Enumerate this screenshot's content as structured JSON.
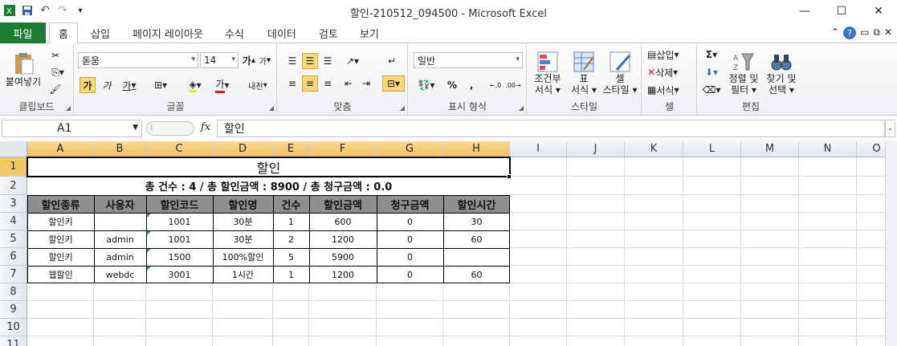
{
  "window": {
    "title": "할인-210512_094500  -  Microsoft Excel",
    "minimize": "—",
    "maximize": "☐",
    "close": "✕"
  },
  "qat": {
    "undo": "↶",
    "redo": "↷",
    "customize": "▾"
  },
  "tabs": {
    "file": "파일",
    "items": [
      "홈",
      "삽입",
      "페이지 레이아웃",
      "수식",
      "데이터",
      "검토",
      "보기"
    ]
  },
  "ribbon": {
    "clipboard": {
      "paste": "붙여넣기",
      "label": "클립보드"
    },
    "font": {
      "name": "돋움",
      "size": "14",
      "grow": "가",
      "shrink": "가",
      "bold": "가",
      "italic": "가",
      "underline": "가",
      "phonetic": "내천",
      "fontcolor": "가",
      "label": "글꼴"
    },
    "align": {
      "label": "맞춤"
    },
    "number": {
      "format": "일반",
      "percent": "%",
      "comma": ",",
      "label": "표시 형식"
    },
    "styles": {
      "cond": [
        "조건부",
        "서식 ▾"
      ],
      "table": [
        "표",
        "서식 ▾"
      ],
      "cell": [
        "셀",
        "스타일 ▾"
      ],
      "label": "스타일"
    },
    "cells": {
      "insert": "삽입",
      "delete": "삭제",
      "format": "서식",
      "label": "셀"
    },
    "editing": {
      "sort": [
        "정렬 및",
        "필터 ▾"
      ],
      "find": [
        "찾기 및",
        "선택 ▾"
      ],
      "sigma": "Σ",
      "label": "편집"
    }
  },
  "formula_bar": {
    "namebox": "A1",
    "fx": "fx",
    "content": "할인"
  },
  "columns": [
    "A",
    "B",
    "C",
    "D",
    "E",
    "F",
    "G",
    "H",
    "I",
    "J",
    "K",
    "L",
    "M",
    "N",
    "O"
  ],
  "rows": [
    "1",
    "2",
    "3",
    "4",
    "5",
    "6",
    "7",
    "8",
    "9",
    "10",
    "11"
  ],
  "sheet": {
    "title": "할인",
    "summary": "총 건수 : 4 / 총 할인금액 : 8900 / 총 청구금액 : 0.0",
    "headers": [
      "할인종류",
      "사용자",
      "할인코드",
      "할인명",
      "건수",
      "할인금액",
      "청구금액",
      "할인시간"
    ],
    "data": [
      [
        "할인키",
        "",
        "1001",
        "30분",
        "1",
        "600",
        "0",
        "30"
      ],
      [
        "할인키",
        "admin",
        "1001",
        "30분",
        "2",
        "1200",
        "0",
        "60"
      ],
      [
        "할인키",
        "admin",
        "1500",
        "100%할인",
        "5",
        "5900",
        "0",
        ""
      ],
      [
        "웹할인",
        "webdc",
        "3001",
        "1시간",
        "1",
        "1200",
        "0",
        "60"
      ]
    ]
  }
}
